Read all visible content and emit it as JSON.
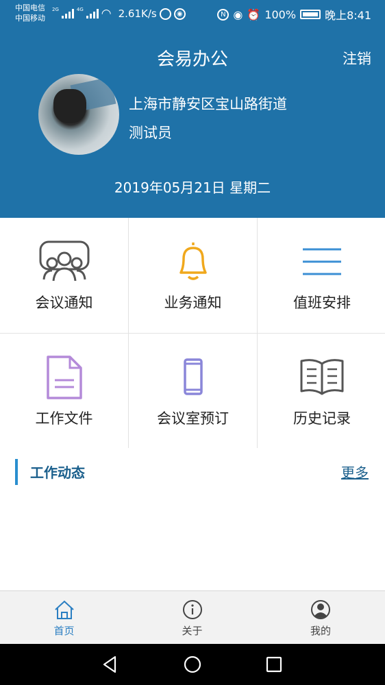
{
  "status_bar": {
    "carrier1": "中国电信",
    "carrier2": "中国移动",
    "net1": "2G",
    "net2": "4G",
    "speed": "2.61K/s",
    "battery": "100%",
    "time": "晚上8:41"
  },
  "header": {
    "app_title": "会易办公",
    "logout_label": "注销",
    "address": "上海市静安区宝山路街道",
    "role": "测试员",
    "date": "2019年05月21日 星期二"
  },
  "grid": {
    "items": [
      {
        "label": "会议通知",
        "icon": "meeting-people-icon"
      },
      {
        "label": "业务通知",
        "icon": "bell-icon"
      },
      {
        "label": "值班安排",
        "icon": "menu-lines-icon"
      },
      {
        "label": "工作文件",
        "icon": "document-icon"
      },
      {
        "label": "会议室预订",
        "icon": "phone-icon"
      },
      {
        "label": "历史记录",
        "icon": "open-book-icon"
      }
    ]
  },
  "work_dynamics": {
    "title": "工作动态",
    "more_label": "更多"
  },
  "tabbar": {
    "tabs": [
      {
        "label": "首页",
        "icon": "home-icon",
        "active": true
      },
      {
        "label": "关于",
        "icon": "info-icon",
        "active": false
      },
      {
        "label": "我的",
        "icon": "user-icon",
        "active": false
      }
    ]
  },
  "colors": {
    "header_bg": "#1f72a8",
    "accent_blue": "#2a7ec2",
    "bell_orange": "#f0a81c",
    "doc_purple": "#b48ad9",
    "phone_purple": "#8a86d9",
    "lines_blue": "#3b8fd4",
    "gray_icon": "#555555"
  }
}
